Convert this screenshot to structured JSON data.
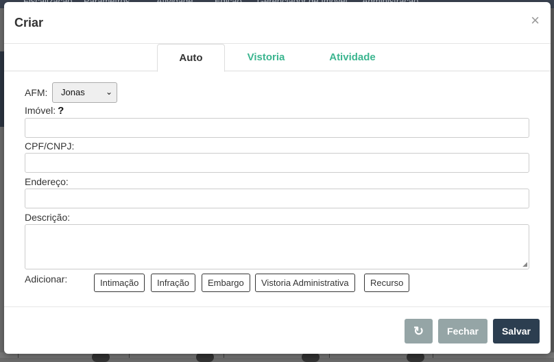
{
  "background": {
    "nav_items": [
      "Fiscalização",
      "Parâmetros",
      "Atividade",
      "Edição",
      "Gerenciador de Imóvel",
      "Administração"
    ]
  },
  "modal": {
    "title": "Criar",
    "close_label": "×",
    "tabs": [
      {
        "label": "Auto",
        "active": true
      },
      {
        "label": "Vistoria",
        "active": false
      },
      {
        "label": "Atividade",
        "active": false
      }
    ]
  },
  "form": {
    "afm_label": "AFM:",
    "afm_value": "Jonas",
    "imovel_label": "Imóvel:",
    "imovel_help": "?",
    "imovel_value": "",
    "cpf_label": "CPF/CNPJ:",
    "cpf_value": "",
    "endereco_label": "Endereço:",
    "endereco_value": "",
    "descricao_label": "Descrição:",
    "descricao_value": "",
    "adicionar_label": "Adicionar:",
    "add_buttons": [
      "Intimação",
      "Infração",
      "Embargo",
      "Vistoria Administrativa",
      "Recurso"
    ]
  },
  "footer": {
    "refresh_icon": "refresh-icon",
    "fechar_label": "Fechar",
    "salvar_label": "Salvar"
  },
  "colors": {
    "tab_link": "#3bb58f",
    "secondary_button": "#95a5a6",
    "primary_button": "#2c3e50"
  }
}
